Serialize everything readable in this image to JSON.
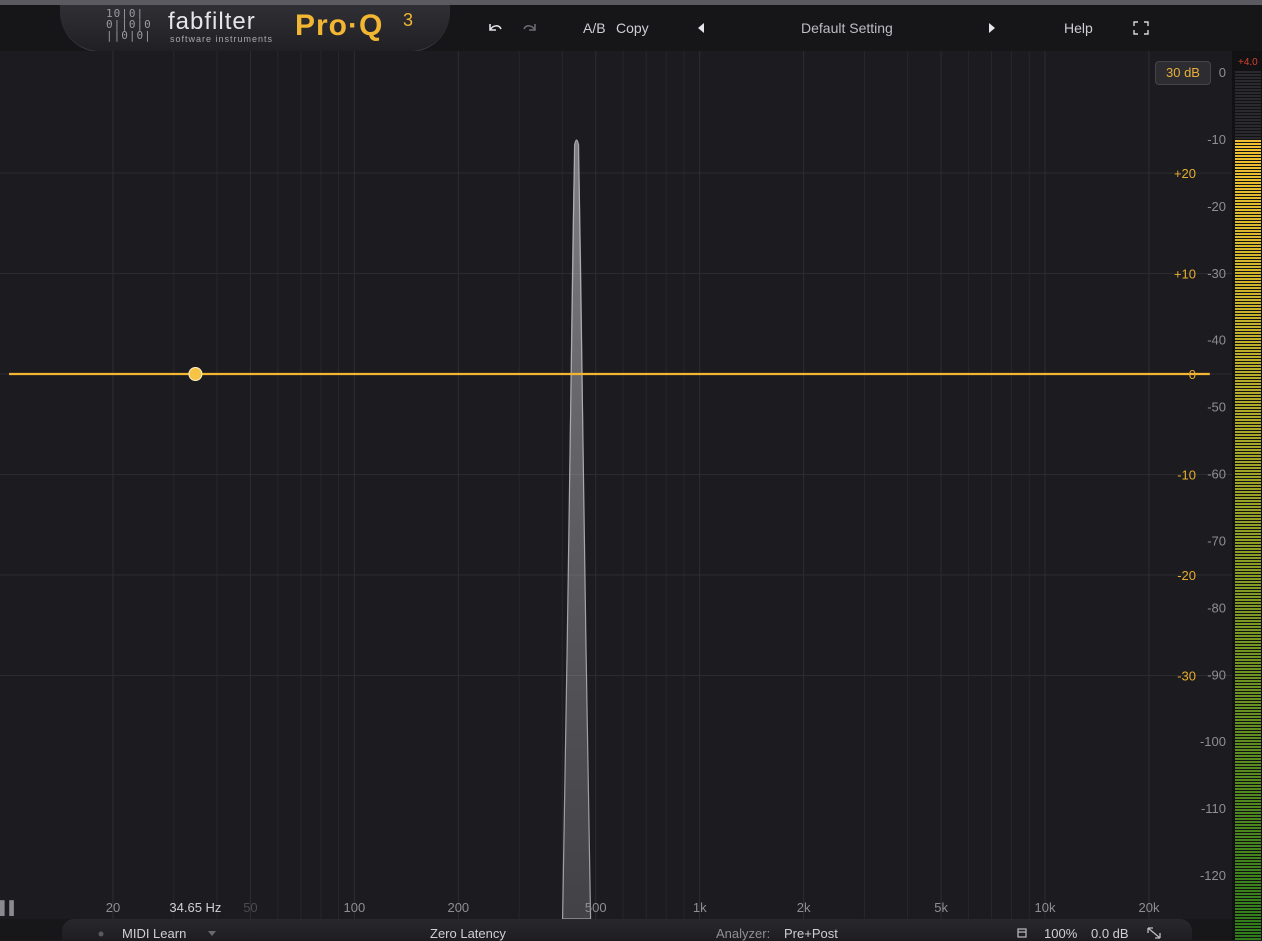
{
  "app": {
    "logo_mark": "10|0|\n0||0|0\n||0|0|",
    "brand": "fabfilter",
    "brand_sub": "software instruments",
    "product": "Pro·Q",
    "product_version": "3"
  },
  "toolbar": {
    "undo_icon": "undo-icon",
    "redo_icon": "redo-icon",
    "ab_label": "A/B",
    "copy_label": "Copy",
    "prev_icon": "triangle-left-icon",
    "preset_name": "Default Setting",
    "next_icon": "triangle-right-icon",
    "help_label": "Help",
    "fullscreen_icon": "fullscreen-icon"
  },
  "display": {
    "range_badge": "30 dB",
    "band_1_freq": "34.65 Hz"
  },
  "chart_data": {
    "type": "line",
    "x_scale": "log",
    "x_ticks": [
      "20",
      "50",
      "100",
      "200",
      "500",
      "1k",
      "2k",
      "5k",
      "10k",
      "20k"
    ],
    "eq_db_ticks": [
      "+20",
      "+10",
      "0",
      "-10",
      "-20",
      "-30"
    ],
    "analyzer_db_ticks": [
      "0",
      "-10",
      "-20",
      "-30",
      "-40",
      "-50",
      "-60",
      "-70",
      "-80",
      "-90",
      "-100",
      "-110",
      "-120"
    ],
    "series": [
      {
        "values_x_hz": [
          10,
          34.65,
          30000
        ],
        "values_y_db": [
          0,
          0,
          0
        ],
        "color": "#f2b632"
      }
    ],
    "band_nodes": [
      {
        "freq_hz": 34.65,
        "gain_db": 0
      }
    ],
    "spectrum_peak": {
      "freq_hz": 440,
      "level_db": -10
    },
    "meter": {
      "peak_label": "+4.0",
      "level_db": -10
    },
    "colors": {
      "eq_curve": "#f2b632",
      "analyzer": "#bdbdc3",
      "meter_top": "#f0c030",
      "meter_bottom": "#2e7d1a"
    }
  },
  "bottom": {
    "midi_learn": "MIDI Learn",
    "latency": "Zero Latency",
    "analyzer_label": "Analyzer:",
    "analyzer_value": "Pre+Post",
    "zoom": "100%",
    "output_gain": "0.0 dB",
    "resize_icon": "resize-icon"
  }
}
